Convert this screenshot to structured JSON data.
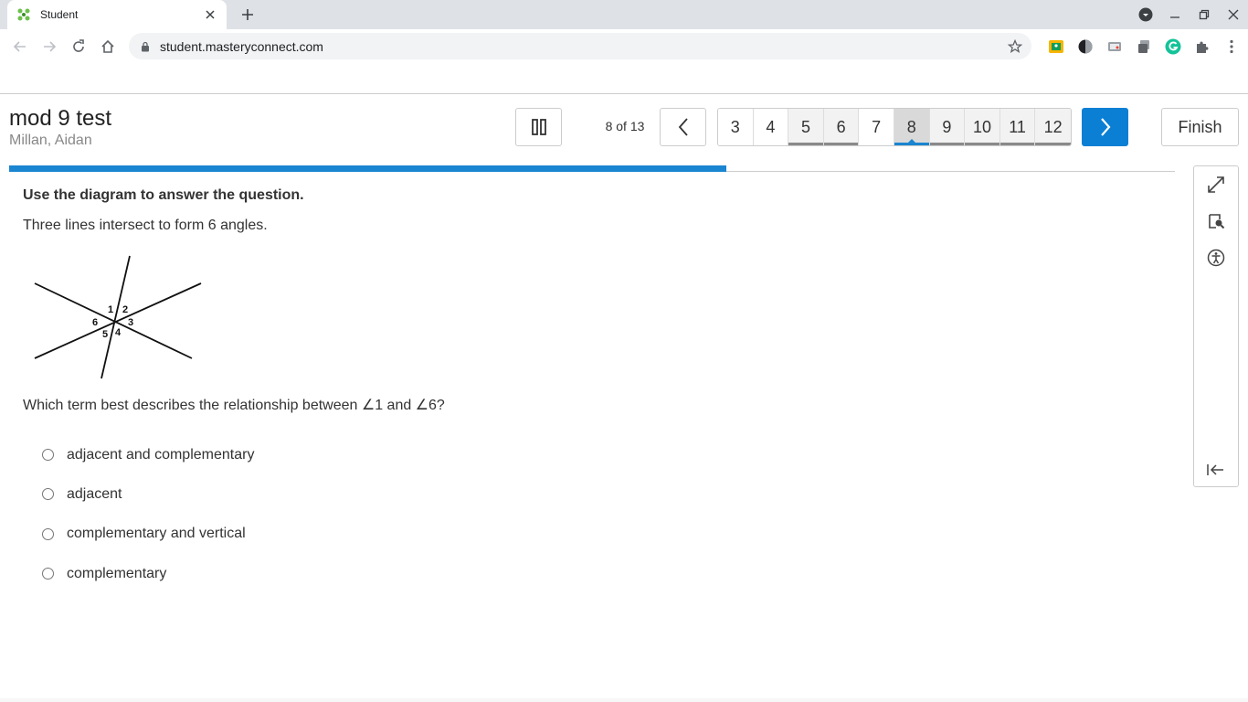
{
  "browser": {
    "tab_title": "Student",
    "url": "student.masteryconnect.com"
  },
  "header": {
    "test_title": "mod 9 test",
    "student_name": "Millan, Aidan",
    "position_text": "8 of 13",
    "pages": [
      "3",
      "4",
      "5",
      "6",
      "7",
      "8",
      "9",
      "10",
      "11",
      "12"
    ],
    "current_page": "8",
    "visited_pages": [
      "5",
      "6",
      "9",
      "10",
      "11",
      "12"
    ],
    "finish_label": "Finish",
    "progress_fraction": 0.615
  },
  "question": {
    "instruction": "Use the diagram to answer the question.",
    "stem": "Three lines intersect to form 6 angles.",
    "prompt": "Which term best describes the relationship between ∠1 and ∠6?",
    "diagram_labels": [
      "1",
      "2",
      "3",
      "4",
      "5",
      "6"
    ],
    "choices": [
      "adjacent and complementary",
      "adjacent",
      "complementary and vertical",
      "complementary"
    ]
  },
  "colors": {
    "accent": "#0a7fd4",
    "progress": "#1a85d0"
  }
}
